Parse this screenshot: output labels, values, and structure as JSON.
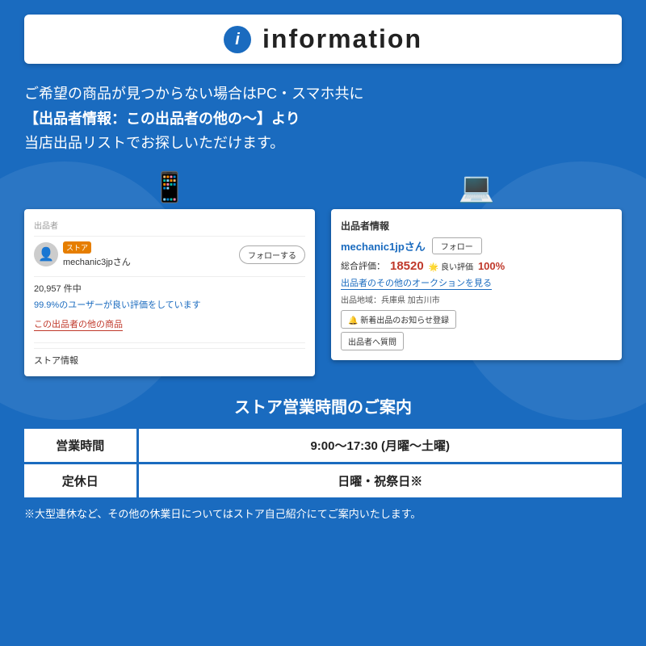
{
  "header": {
    "title": "information",
    "icon_label": "i"
  },
  "intro": {
    "line1": "ご希望の商品が見つからない場合はPC・スマホ共に",
    "line2": "【出品者情報：この出品者の他の〜】より",
    "line3": "当店出品リストでお探しいただけます。"
  },
  "left_screenshot": {
    "device_icon": "📱",
    "label": "出品者",
    "store_badge": "ストア",
    "seller_name": "mechanic3jpさん",
    "follow_btn": "フォローする",
    "count": "20,957 件中",
    "rating_text": "99.9%のユーザーが良い評価をしています",
    "other_items_link": "この出品者の他の商品",
    "store_info": "ストア情報"
  },
  "right_screenshot": {
    "device_icon": "💻",
    "title": "出品者情報",
    "seller_name": "mechanic1jpさん",
    "follow_btn": "フォロー",
    "rating_label": "総合評価：",
    "rating_num": "18520",
    "good_label": "🌟 良い評価",
    "good_pct": "100%",
    "auction_link": "出品者のその他のオークションを見る",
    "location_label": "出品地域：兵庫県 加古川市",
    "notify_btn": "🔔 新着出品のお知らせ登録",
    "question_btn": "出品者へ質問"
  },
  "store_hours": {
    "title": "ストア営業時間のご案内",
    "rows": [
      {
        "label": "営業時間",
        "value": "9:00〜17:30 (月曜〜土曜)"
      },
      {
        "label": "定休日",
        "value": "日曜・祝祭日※"
      }
    ],
    "footnote": "※大型連休など、その他の休業日についてはストア自己紹介にてご案内いたします。"
  }
}
